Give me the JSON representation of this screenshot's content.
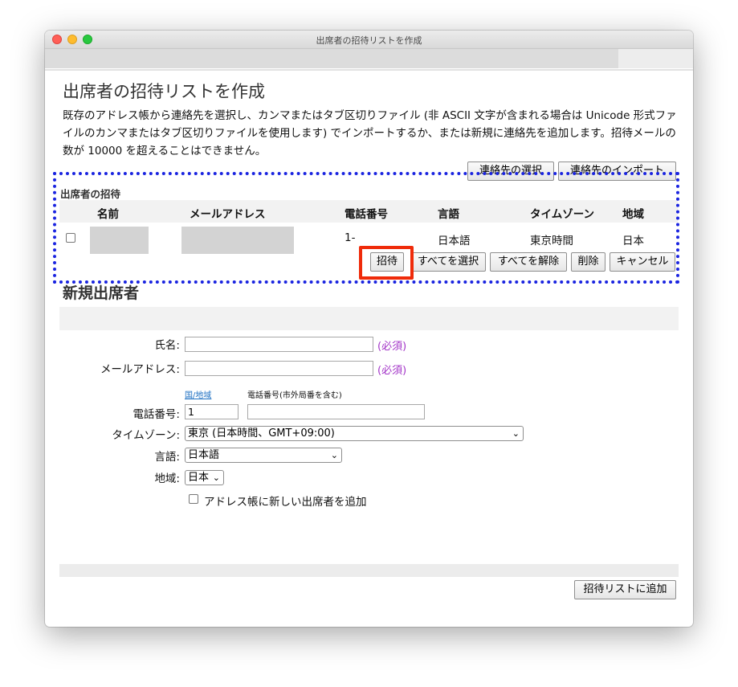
{
  "window": {
    "title": "出席者の招待リストを作成"
  },
  "page": {
    "heading": "出席者の招待リストを作成",
    "description": "既存のアドレス帳から連絡先を選択し、カンマまたはタブ区切りファイル (非 ASCII 文字が含まれる場合は Unicode 形式ファイルのカンマまたはタブ区切りファイルを使用します) でインポートするか、または新規に連絡先を追加します。招待メールの数が 10000 を超えることはできません。"
  },
  "top_buttons": {
    "select_contacts": "連絡先の選択",
    "import_contacts": "連絡先のインポート"
  },
  "invite_section": {
    "title": "出席者の招待",
    "columns": [
      "名前",
      "メールアドレス",
      "電話番号",
      "言語",
      "タイムゾーン",
      "地域"
    ],
    "row": {
      "name": "",
      "email": "",
      "phone": "1-",
      "language": "日本語",
      "timezone": "東京時間",
      "region": "日本"
    },
    "buttons": {
      "invite": "招待",
      "select_all": "すべてを選択",
      "deselect_all": "すべてを解除",
      "delete": "削除",
      "cancel": "キャンセル"
    }
  },
  "new_attendee": {
    "heading": "新規出席者",
    "name_label": "氏名:",
    "email_label": "メールアドレス:",
    "required": "(必須)",
    "country_link": "国/地域",
    "phone_hint": "電話番号(市外局番を含む)",
    "phone_label": "電話番号:",
    "country_code": "1",
    "phone_number": "",
    "timezone_label": "タイムゾーン:",
    "timezone_value": "東京 (日本時間、GMT+09:00)",
    "language_label": "言語:",
    "language_value": "日本語",
    "region_label": "地域:",
    "region_value": "日本",
    "add_to_addressbook": "アドレス帳に新しい出席者を追加"
  },
  "footer": {
    "add_to_list": "招待リストに追加"
  },
  "annotations": {
    "highlight_blue": "#1a24e0",
    "highlight_red": "#ef2b0a"
  }
}
